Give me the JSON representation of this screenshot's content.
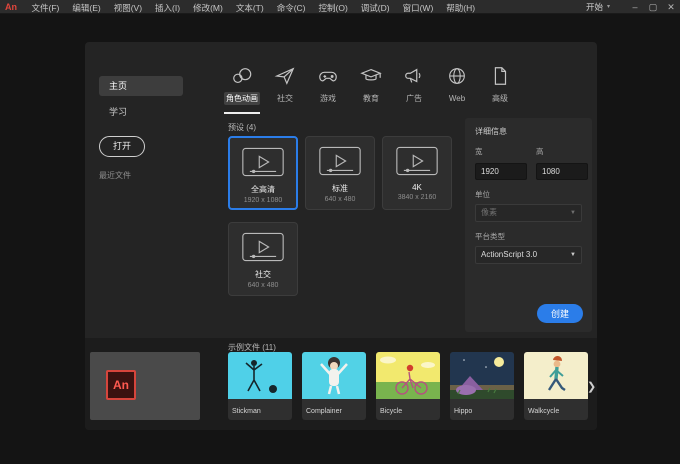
{
  "colors": {
    "accent": "#2b7de9",
    "tab_icon": "#c4c4c4"
  },
  "titlebar": {
    "app_icon": "An",
    "menus": [
      "文件(F)",
      "编辑(E)",
      "视图(V)",
      "插入(I)",
      "修改(M)",
      "文本(T)",
      "命令(C)",
      "控制(O)",
      "调试(D)",
      "窗口(W)",
      "帮助(H)"
    ],
    "workspace": {
      "label": "开始",
      "caret": "▾"
    },
    "window_controls": {
      "minimize": "–",
      "maximize": "▢",
      "close": "✕"
    }
  },
  "sidebar": {
    "items": [
      {
        "label": "主页",
        "active": true
      },
      {
        "label": "学习",
        "active": false
      }
    ],
    "open_button": "打开",
    "recent_label": "最近文件"
  },
  "tabs": [
    {
      "label": "角色动画",
      "icon": "character-animation-icon",
      "active": true
    },
    {
      "label": "社交",
      "icon": "paper-plane-icon",
      "active": false
    },
    {
      "label": "游戏",
      "icon": "game-controller-icon",
      "active": false
    },
    {
      "label": "教育",
      "icon": "graduation-cap-icon",
      "active": false
    },
    {
      "label": "广告",
      "icon": "megaphone-icon",
      "active": false
    },
    {
      "label": "Web",
      "icon": "globe-icon",
      "active": false
    },
    {
      "label": "高级",
      "icon": "document-icon",
      "active": false
    }
  ],
  "presets": {
    "title": "预设 (4)",
    "cards": [
      {
        "name": "全高清",
        "dims": "1920 x 1080",
        "selected": true
      },
      {
        "name": "标准",
        "dims": "640 x 480",
        "selected": false
      },
      {
        "name": "4K",
        "dims": "3840 x 2160",
        "selected": false
      },
      {
        "name": "社交",
        "dims": "640 x 480",
        "selected": false
      }
    ]
  },
  "details": {
    "title": "详细信息",
    "width_label": "宽",
    "width_value": "1920",
    "height_label": "高",
    "height_value": "1080",
    "units_label": "单位",
    "units_value": "像素",
    "platform_label": "平台类型",
    "platform_value": "ActionScript 3.0",
    "create_button": "创建"
  },
  "samples": {
    "title": "示例文件 (11)",
    "items": [
      {
        "label": "Stickman",
        "scene": "stickman"
      },
      {
        "label": "Complainer",
        "scene": "complainer"
      },
      {
        "label": "Bicycle",
        "scene": "bicycle"
      },
      {
        "label": "Hippo",
        "scene": "hippo"
      },
      {
        "label": "Walkcycle",
        "scene": "walkcycle"
      }
    ],
    "chevron": "❯"
  },
  "banner_logo": "An"
}
